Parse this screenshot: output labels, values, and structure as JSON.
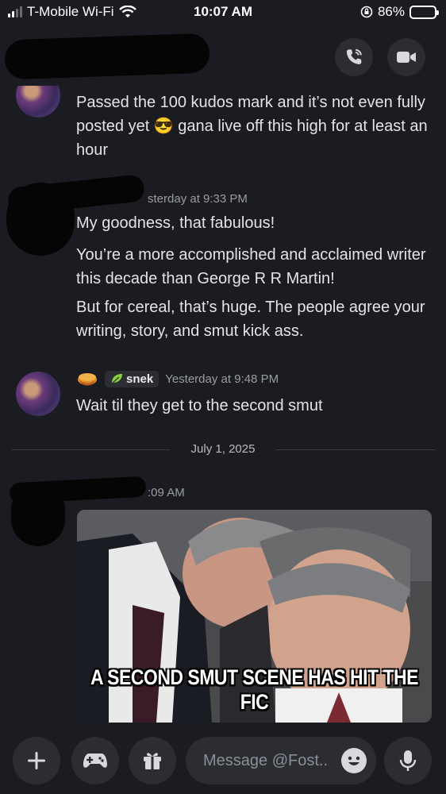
{
  "status_bar": {
    "carrier": "T-Mobile Wi-Fi",
    "time": "10:07 AM",
    "battery": "86%",
    "battery_level": 0.86
  },
  "header": {
    "call_icon": "phone-call-icon",
    "video_icon": "video-camera-icon"
  },
  "messages": [
    {
      "text": "Passed the 100 kudos mark and it’s not even fully posted yet 😎 gana live off this high for at least an hour"
    },
    {
      "timestamp": "sterday at 9:33 PM",
      "paragraphs": [
        "My goodness, that fabulous!",
        "You’re a more accomplished and acclaimed writer this decade than George R R Martin!",
        "But for cereal, that’s huge. The people agree your writing, story, and smut kick ass."
      ]
    },
    {
      "author_tag": "snek",
      "timestamp": "Yesterday at 9:48 PM",
      "text": "Wait til they get to the second smut"
    }
  ],
  "date_divider": "July 1, 2025",
  "last_message": {
    "timestamp": ":09 AM",
    "image_caption": "A SECOND SMUT SCENE HAS HIT THE FIC"
  },
  "composer": {
    "placeholder": "Message @Fost..",
    "buttons": [
      "plus-icon",
      "gamepad-icon",
      "gift-icon",
      "emoji-icon",
      "microphone-icon"
    ]
  }
}
